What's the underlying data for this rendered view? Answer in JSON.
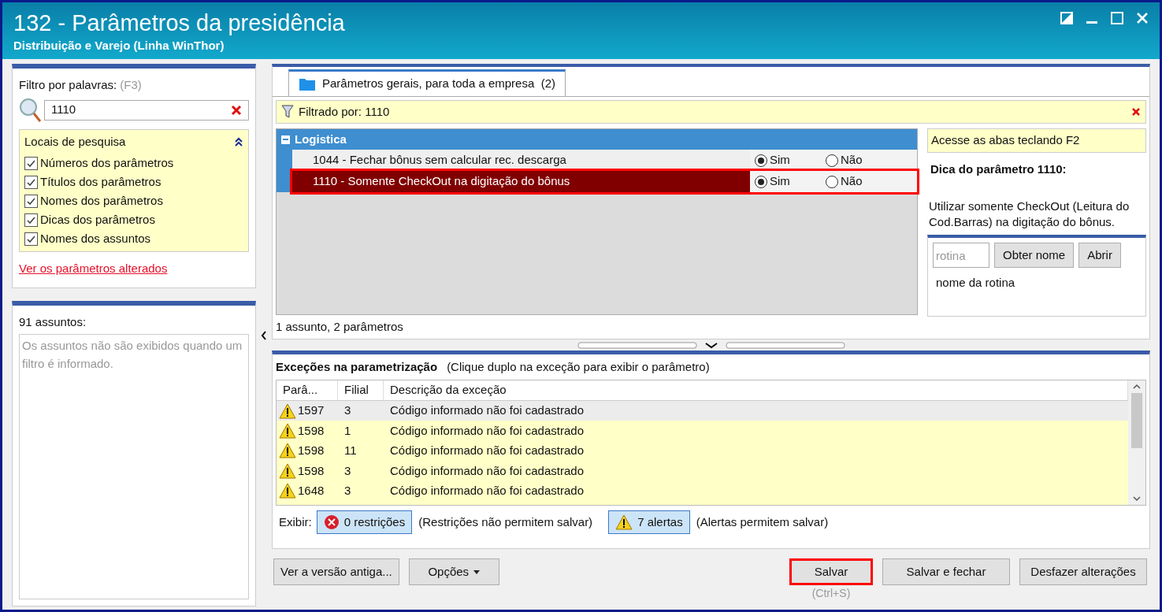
{
  "window": {
    "title": "132 - Parâmetros da presidência",
    "subtitle": "Distribuição e Varejo (Linha WinThor)"
  },
  "filter": {
    "label": "Filtro por palavras:",
    "shortcut": "(F3)",
    "value": "1110"
  },
  "search_places": {
    "title": "Locais de pesquisa",
    "expanded": true,
    "options": [
      {
        "label": "Números dos parâmetros",
        "checked": true
      },
      {
        "label": "Títulos dos parâmetros",
        "checked": true
      },
      {
        "label": "Nomes dos parâmetros",
        "checked": true
      },
      {
        "label": "Dicas dos parâmetros",
        "checked": true
      },
      {
        "label": "Nomes dos assuntos",
        "checked": true
      }
    ]
  },
  "changed_link": "Ver os parâmetros alterados",
  "subjects": {
    "count": "91 assuntos:",
    "message": "Os assuntos não são exibidos quando um filtro é informado."
  },
  "tabs": [
    {
      "label": "Parâmetros gerais, para toda a empresa  (2)",
      "selected": true
    }
  ],
  "filter_bar": {
    "text": "Filtrado por: 1110"
  },
  "group": {
    "name": "Logistica",
    "expanded": true,
    "params": [
      {
        "label": "1044 - Fechar bônus sem calcular rec. descarga",
        "selected": false,
        "highlighted": false,
        "options": [
          {
            "label": "Sim",
            "selected": true
          },
          {
            "label": "Não",
            "selected": false
          }
        ]
      },
      {
        "label": "1110 - Somente CheckOut na digitação do bônus",
        "selected": true,
        "highlighted": true,
        "options": [
          {
            "label": "Sim",
            "selected": true
          },
          {
            "label": "Não",
            "selected": false
          }
        ]
      }
    ]
  },
  "summary": "1 assunto, 2 parâmetros",
  "hint_panel": {
    "notice": "Acesse as abas teclando F2",
    "title": "Dica do parâmetro 1110:",
    "text": "Utilizar somente CheckOut (Leitura do Cod.Barras) na digitação do bônus."
  },
  "routine": {
    "placeholder": "rotina",
    "buttons": [
      "Obter nome",
      "Abrir"
    ],
    "name_label": "nome da rotina"
  },
  "exceptions": {
    "title": "Exceções na parametrização",
    "subtitle": "(Clique duplo na exceção para exibir o parâmetro)",
    "columns": [
      "Parâ...",
      "Filial",
      "Descrição da exceção"
    ],
    "rows": [
      {
        "param": "1597",
        "branch": "3",
        "description": "Código informado não foi cadastrado",
        "selected": true
      },
      {
        "param": "1598",
        "branch": "1",
        "description": "Código informado não foi cadastrado",
        "selected": false
      },
      {
        "param": "1598",
        "branch": "11",
        "description": "Código informado não foi cadastrado",
        "selected": false
      },
      {
        "param": "1598",
        "branch": "3",
        "description": "Código informado não foi cadastrado",
        "selected": false
      },
      {
        "param": "1648",
        "branch": "3",
        "description": "Código informado não foi cadastrado",
        "selected": false
      }
    ]
  },
  "display": {
    "label": "Exibir:",
    "filters": [
      {
        "kind": "error",
        "label": "0 restrições",
        "note": "(Restrições não permitem salvar)"
      },
      {
        "kind": "warning",
        "label": "7 alertas",
        "note": "(Alertas permitem salvar)"
      }
    ]
  },
  "footer": {
    "left_buttons": [
      {
        "label": "Ver a versão antiga...",
        "dropdown": false
      },
      {
        "label": "Opções",
        "dropdown": true
      }
    ],
    "right_buttons": [
      {
        "label": "Salvar",
        "shortcut": "(Ctrl+S)",
        "highlighted": true
      },
      {
        "label": "Salvar e fechar",
        "highlighted": false
      },
      {
        "label": "Desfazer alterações",
        "highlighted": false
      }
    ]
  }
}
